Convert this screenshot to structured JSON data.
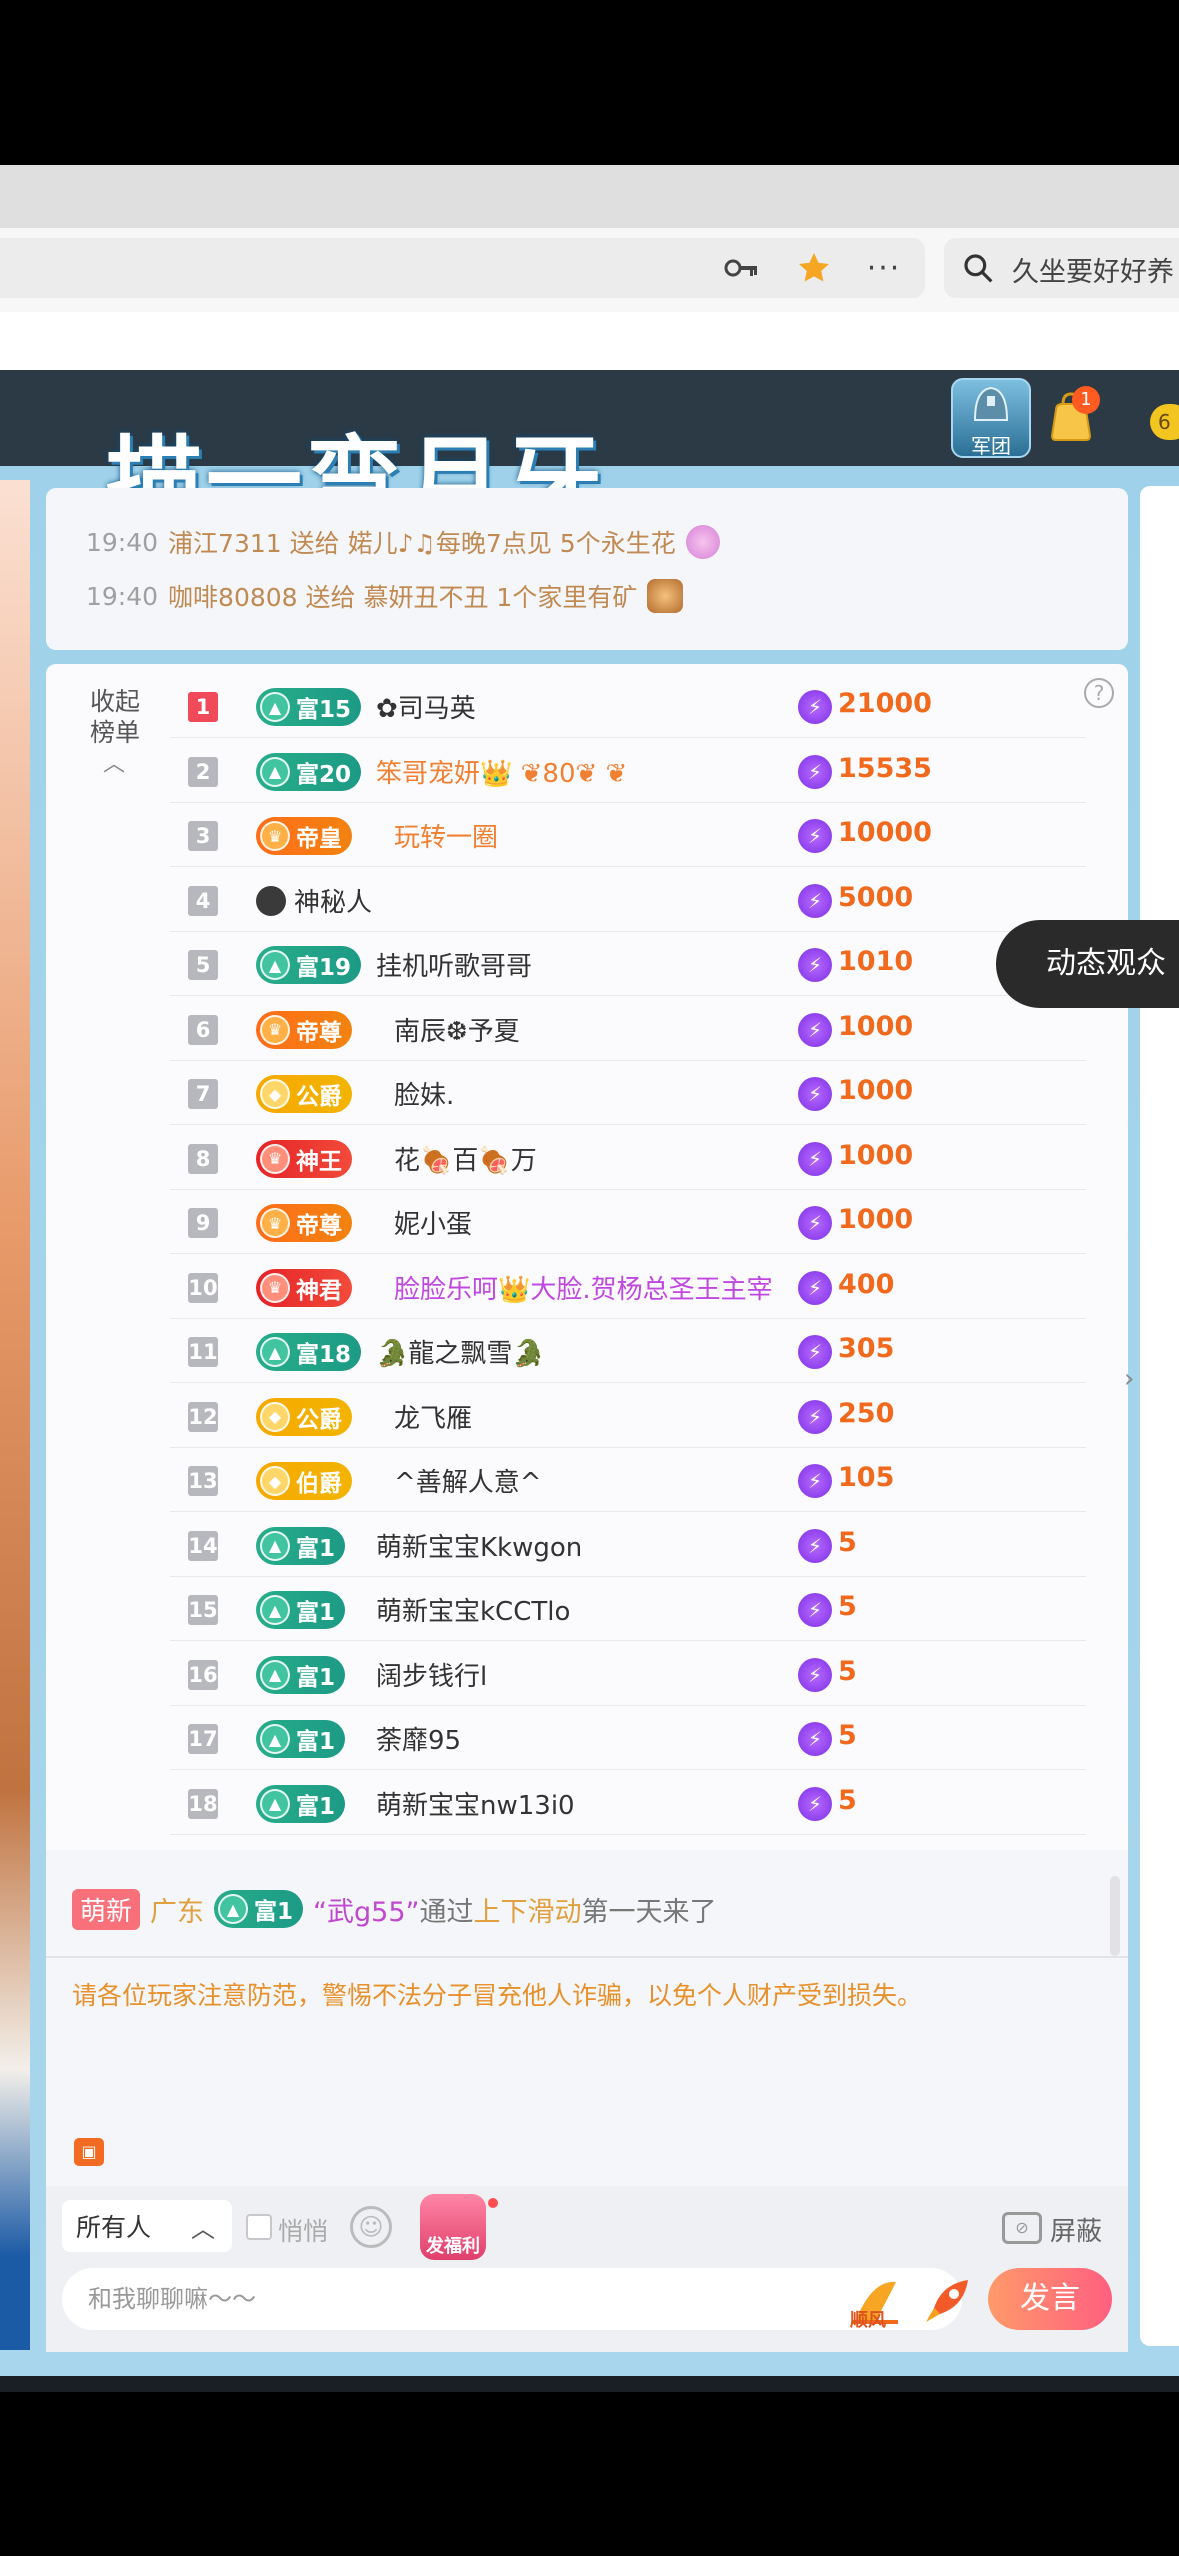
{
  "browser": {
    "search_text": "久坐要好好养"
  },
  "room": {
    "title": "描一弯月牙",
    "army_label": "军团",
    "bag_badge": "1",
    "coin_partial": "6"
  },
  "gift_feed": [
    {
      "time": "19:40",
      "text": "浦江7311 送给 婼儿♪♫每晚7点见 5个永生花"
    },
    {
      "time": "19:40",
      "text": "咖啡80808 送给 慕妍丑不丑 1个家里有矿"
    }
  ],
  "ranking": {
    "collapse_label": "收起榜单",
    "help": "?",
    "rows": [
      {
        "rank": "1",
        "badge": "富15",
        "name": "✿司马英",
        "amount": "21000"
      },
      {
        "rank": "2",
        "badge": "富20",
        "name": "笨哥宠妍👑 ❦80❦ ❦",
        "amount": "15535"
      },
      {
        "rank": "3",
        "badge": "帝皇",
        "name": "玩转一圈",
        "amount": "10000"
      },
      {
        "rank": "4",
        "badge": "",
        "name": "神秘人",
        "amount": "5000"
      },
      {
        "rank": "5",
        "badge": "富19",
        "name": "挂机听歌哥哥",
        "amount": "1010"
      },
      {
        "rank": "6",
        "badge": "帝尊",
        "name": "南辰❆予夏",
        "amount": "1000"
      },
      {
        "rank": "7",
        "badge": "公爵",
        "name": "脸妹.",
        "amount": "1000"
      },
      {
        "rank": "8",
        "badge": "神王",
        "name": "花🍖百🍖万",
        "amount": "1000"
      },
      {
        "rank": "9",
        "badge": "帝尊",
        "name": "妮小蛋",
        "amount": "1000"
      },
      {
        "rank": "10",
        "badge": "神君",
        "name": "脸脸乐呵👑大脸.贺杨总圣王主宰",
        "amount": "400"
      },
      {
        "rank": "11",
        "badge": "富18",
        "name": "🐊龍之飘雪🐊",
        "amount": "305"
      },
      {
        "rank": "12",
        "badge": "公爵",
        "name": "龙飞雁",
        "amount": "250"
      },
      {
        "rank": "13",
        "badge": "伯爵",
        "name": "^善解人意^",
        "amount": "105"
      },
      {
        "rank": "14",
        "badge": "富1",
        "name": "萌新宝宝Kkwgon",
        "amount": "5"
      },
      {
        "rank": "15",
        "badge": "富1",
        "name": "萌新宝宝kCCTlo",
        "amount": "5"
      },
      {
        "rank": "16",
        "badge": "富1",
        "name": "阔步钱行l",
        "amount": "5"
      },
      {
        "rank": "17",
        "badge": "富1",
        "name": "荼靡95",
        "amount": "5"
      },
      {
        "rank": "18",
        "badge": "富1",
        "name": "萌新宝宝nw13i0",
        "amount": "5"
      }
    ]
  },
  "chat": {
    "tag_new": "萌新",
    "province": "广东",
    "user_badge": "富1",
    "user_name": "“武g55”",
    "via": "通过",
    "via_link": "上下滑动",
    "suffix": "第一天来了",
    "warning": "请各位玩家注意防范，警惕不法分子冒充他人诈骗，以免个人财产受到损失。"
  },
  "input": {
    "audience": "所有人",
    "whisper": "悄悄",
    "redpack_label": "发福利",
    "block_label": "屏蔽",
    "placeholder": "和我聊聊嘛～～",
    "sail_label": "顺风",
    "send_label": "发言"
  },
  "overlay": {
    "tooltip": "动态观众"
  },
  "colors": {
    "accent_orange": "#f0691c",
    "rank_top": "#f04a5a",
    "send_gradient_start": "#ff9a6a",
    "send_gradient_end": "#ff5f7f"
  }
}
